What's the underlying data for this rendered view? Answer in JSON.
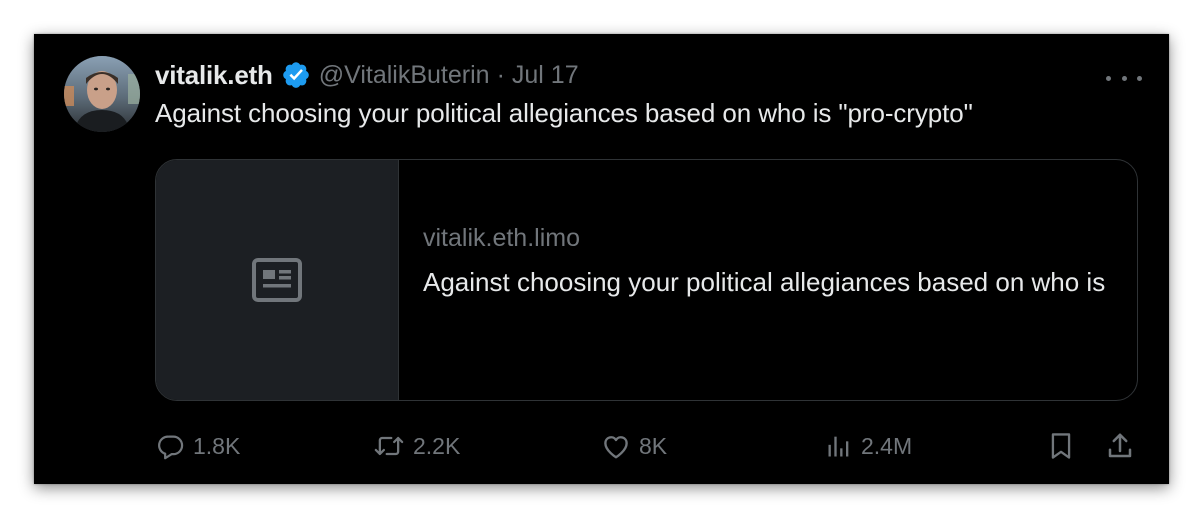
{
  "tweet": {
    "author": {
      "display_name": "vitalik.eth",
      "handle": "@VitalikButerin",
      "verified": true
    },
    "separator": "·",
    "timestamp": "Jul 17",
    "text": "Against choosing your political allegiances based on who is \"pro-crypto\""
  },
  "link_card": {
    "domain": "vitalik.eth.limo",
    "title": "Against choosing your political allegiances based on who is",
    "thumbnail_icon": "article-icon"
  },
  "actions": {
    "replies": "1.8K",
    "reposts": "2.2K",
    "likes": "8K",
    "views": "2.4M"
  },
  "icons": {
    "verified": "verified-badge-icon",
    "more": "more-horizontal-icon",
    "reply": "reply-icon",
    "repost": "repost-icon",
    "like": "heart-icon",
    "views": "views-bar-chart-icon",
    "bookmark": "bookmark-icon",
    "share": "share-icon"
  },
  "colors": {
    "background": "#000000",
    "primary_text": "#e7e9ea",
    "secondary_text": "#71767b",
    "verified_blue": "#1d9bf0",
    "card_border": "#2f3336",
    "thumbnail_bg": "#1c1f23"
  }
}
